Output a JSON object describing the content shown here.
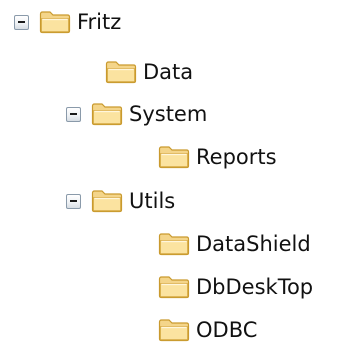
{
  "tree": {
    "nodes": [
      {
        "label": "Fritz",
        "expanded": true,
        "has_toggle": true,
        "depth": 0
      },
      {
        "label": "Data",
        "expanded": false,
        "has_toggle": false,
        "depth": 1
      },
      {
        "label": "System",
        "expanded": true,
        "has_toggle": true,
        "depth": 1
      },
      {
        "label": "Reports",
        "expanded": false,
        "has_toggle": false,
        "depth": 2
      },
      {
        "label": "Utils",
        "expanded": true,
        "has_toggle": true,
        "depth": 1
      },
      {
        "label": "DataShield",
        "expanded": false,
        "has_toggle": false,
        "depth": 2
      },
      {
        "label": "DbDeskTop",
        "expanded": false,
        "has_toggle": false,
        "depth": 2
      },
      {
        "label": "ODBC",
        "expanded": false,
        "has_toggle": false,
        "depth": 2
      }
    ]
  },
  "icons": {
    "toggle": "collapse-minus-icon",
    "folder": "folder-icon"
  },
  "colors": {
    "folder_fill": "#f4d58a",
    "folder_light": "#fbe9b6",
    "folder_outline": "#c99a2e",
    "toggle_border": "#8a9aaa",
    "text": "#111111",
    "background": "#ffffff"
  }
}
